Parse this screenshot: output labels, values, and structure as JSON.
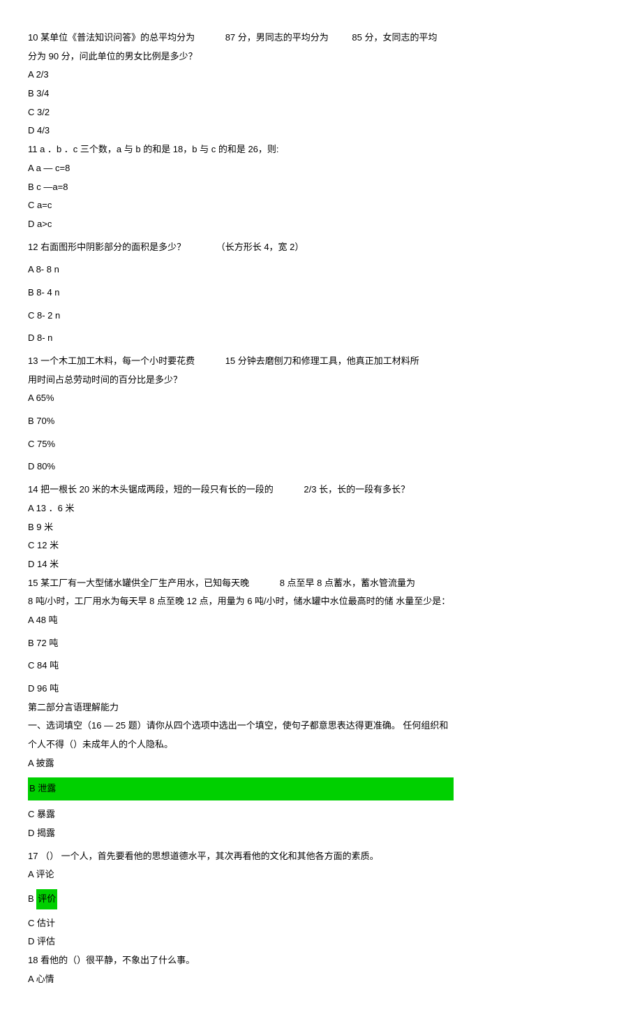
{
  "q10": {
    "text_p1": "10 某单位《普法知识问答》的总平均分为",
    "text_p2": "87 分，男同志的平均分为",
    "text_p3": "85 分，女同志的平均",
    "text_line2": "分为 90 分，问此单位的男女比例是多少？",
    "a": "A 2/3",
    "b": "B 3/4",
    "c": "C 3/2",
    "d": "D 4/3"
  },
  "q11": {
    "text": "11 a ．b ．c 三个数，a 与 b 的和是 18，b 与 c 的和是 26，则:",
    "a": "A a — c=8",
    "b": "B c —a=8",
    "c": "C a=c",
    "d": "D a>c"
  },
  "q12": {
    "text_p1": "12 右面图形中阴影部分的面积是多少？",
    "text_p2": "（长方形长 4，宽 2）",
    "a": "A 8- 8 n",
    "b": "B 8- 4 n",
    "c": "C 8- 2 n",
    "d": "D 8- n"
  },
  "q13": {
    "text_p1": "13 一个木工加工木料，每一个小时要花费",
    "text_p2": "15 分钟去磨刨刀和修理工具，他真正加工材料所",
    "text_line2": "用时间占总劳动时间的百分比是多少？",
    "a": "A 65%",
    "b": "B 70%",
    "c": "C 75%",
    "d": "D 80%"
  },
  "q14": {
    "text_p1": "14 把一根长 20 米的木头锯成两段，短的一段只有长的一段的",
    "text_p2": "2/3 长，长的一段有多长？",
    "a": "A 13 ．6 米",
    "b": "B 9 米",
    "c": "C 12 米",
    "d": "D 14 米"
  },
  "q15": {
    "text_p1": "15 某工厂有一大型储水罐供全厂生产用水，已知每天晚",
    "text_p2": "8 点至早 8 点蓄水，蓄水管流量为",
    "text_line2": "8 吨/小时，工厂用水为每天早  8 点至晚 12 点，用量为 6 吨/小时，储水罐中水位最高时的储  水量至少是：",
    "a": "A 48 吨",
    "b": "B 72 吨",
    "c": "C 84 吨",
    "d": "D 96 吨"
  },
  "section2": {
    "title": "第二部分言语理解能力",
    "intro_p1": "一、选词填空（16 — 25 题）请你从四个选项中选出一个填空，使句子都意思表达得更准确。 任何组织和",
    "intro_p2": "个人不得（）未成年人的个人隐私。"
  },
  "q16": {
    "a": "A 披露",
    "b": "B 泄露",
    "c": "C 暴露",
    "d": "D 揭露"
  },
  "q17": {
    "text": "17    （）  一个人，首先要看他的思想道德水平，其次再看他的文化和其他各方面的素质。",
    "a": "A 评论",
    "b_pre": "B ",
    "b_hl": "评价",
    "c": "C 估计",
    "d": "D 评估"
  },
  "q18": {
    "text": "18 看他的（）很平静，不象出了什么事。",
    "a": "A 心情"
  }
}
